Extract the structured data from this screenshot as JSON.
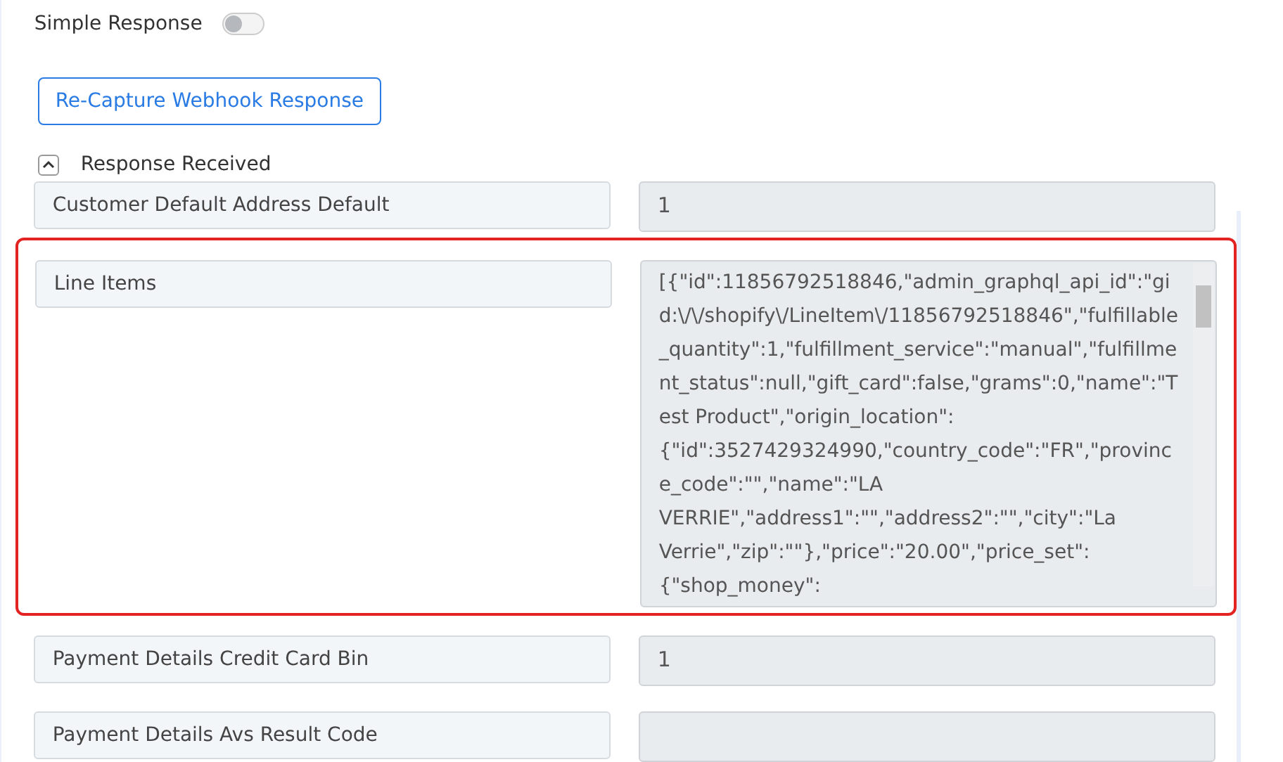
{
  "simple_response": {
    "label": "Simple Response",
    "on": false
  },
  "recapture_button": "Re-Capture Webhook Response",
  "section": {
    "title": "Response Received",
    "expanded": true
  },
  "fields": [
    {
      "label": "Customer Default Address Default",
      "value": "1",
      "highlighted": false,
      "kind": "short"
    },
    {
      "label": "Line Items",
      "value": "[{\"id\":11856792518846,\"admin_graphql_api_id\":\"gid:\\/\\/shopify\\/LineItem\\/11856792518846\",\"fulfillable_quantity\":1,\"fulfillment_service\":\"manual\",\"fulfillment_status\":null,\"gift_card\":false,\"grams\":0,\"name\":\"Test Product\",\"origin_location\":{\"id\":3527429324990,\"country_code\":\"FR\",\"province_code\":\"\",\"name\":\"LA VERRIE\",\"address1\":\"\",\"address2\":\"\",\"city\":\"La Verrie\",\"zip\":\"\"},\"price\":\"20.00\",\"price_set\":{\"shop_money\":",
      "highlighted": true,
      "kind": "long"
    },
    {
      "label": "Payment Details Credit Card Bin",
      "value": "1",
      "highlighted": false,
      "kind": "short"
    },
    {
      "label": "Payment Details Avs Result Code",
      "highlighted": false,
      "kind": "short"
    }
  ]
}
